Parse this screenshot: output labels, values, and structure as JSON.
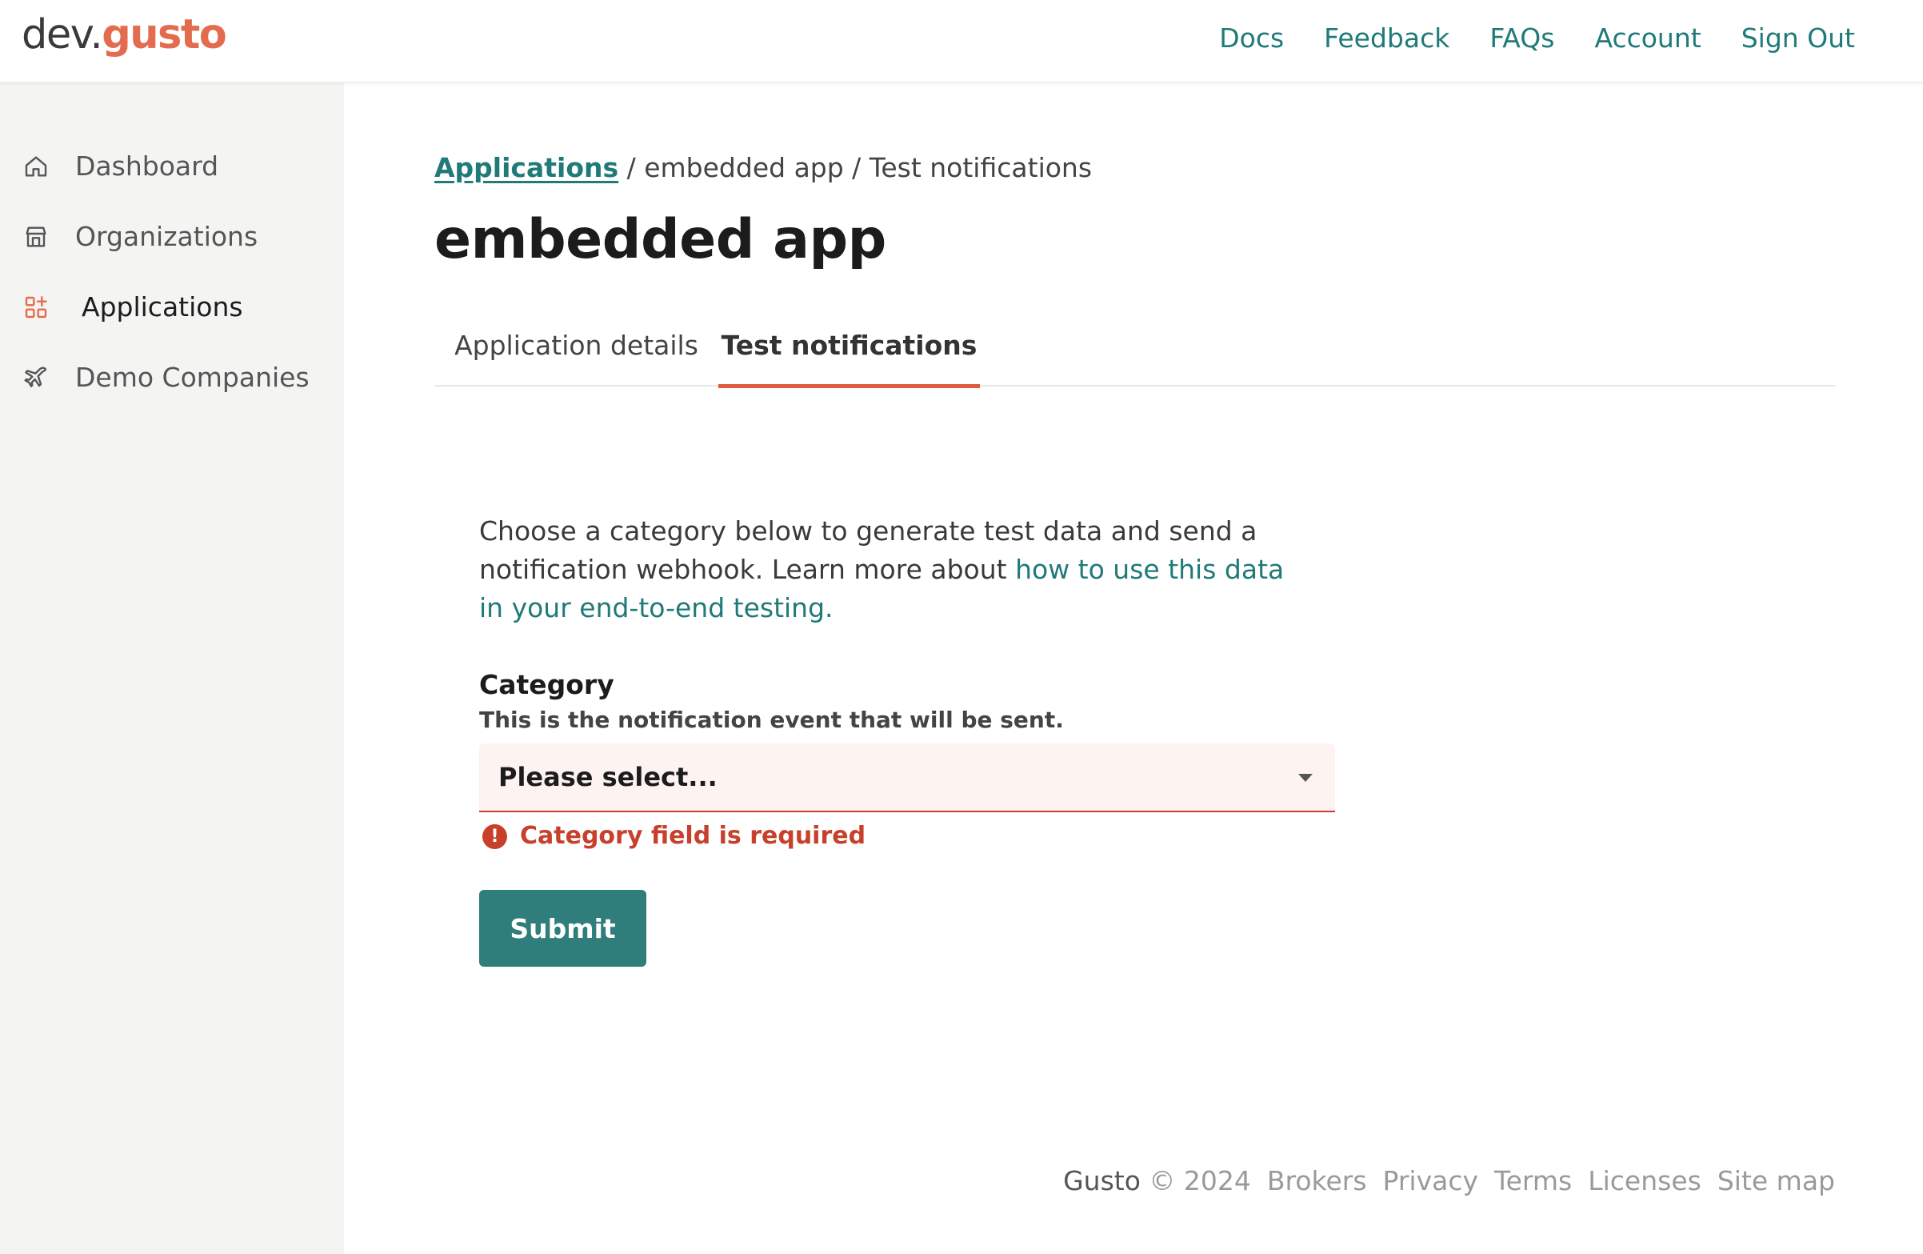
{
  "header": {
    "logo_dev": "dev.",
    "logo_brand": "gusto",
    "nav": [
      "Docs",
      "Feedback",
      "FAQs",
      "Account",
      "Sign Out"
    ]
  },
  "sidebar": {
    "items": [
      {
        "label": "Dashboard",
        "icon": "home-icon"
      },
      {
        "label": "Organizations",
        "icon": "store-icon"
      },
      {
        "label": "Applications",
        "icon": "apps-grid-icon",
        "active": true
      },
      {
        "label": "Demo Companies",
        "icon": "airplane-icon"
      }
    ]
  },
  "breadcrumb": {
    "link": "Applications",
    "rest": " / embedded app / Test notifications"
  },
  "page_title": "embedded app",
  "tabs": [
    {
      "label": "Application details"
    },
    {
      "label": "Test notifications",
      "active": true
    }
  ],
  "intro": {
    "text": "Choose a category below to generate test data and send a notification webhook. Learn more about ",
    "link": "how to use this data in your end-to-end testing."
  },
  "form": {
    "label": "Category",
    "help": "This is the notification event that will be sent.",
    "select_value": "Please select...",
    "error": "Category field is required",
    "submit": "Submit"
  },
  "footer": {
    "brand": "Gusto",
    "year": "© 2024",
    "links": [
      "Brokers",
      "Privacy",
      "Terms",
      "Licenses",
      "Site map"
    ]
  },
  "colors": {
    "accent": "#1f7a78",
    "brand": "#e36c4f",
    "error": "#c7402c",
    "button": "#2f7e7c"
  }
}
